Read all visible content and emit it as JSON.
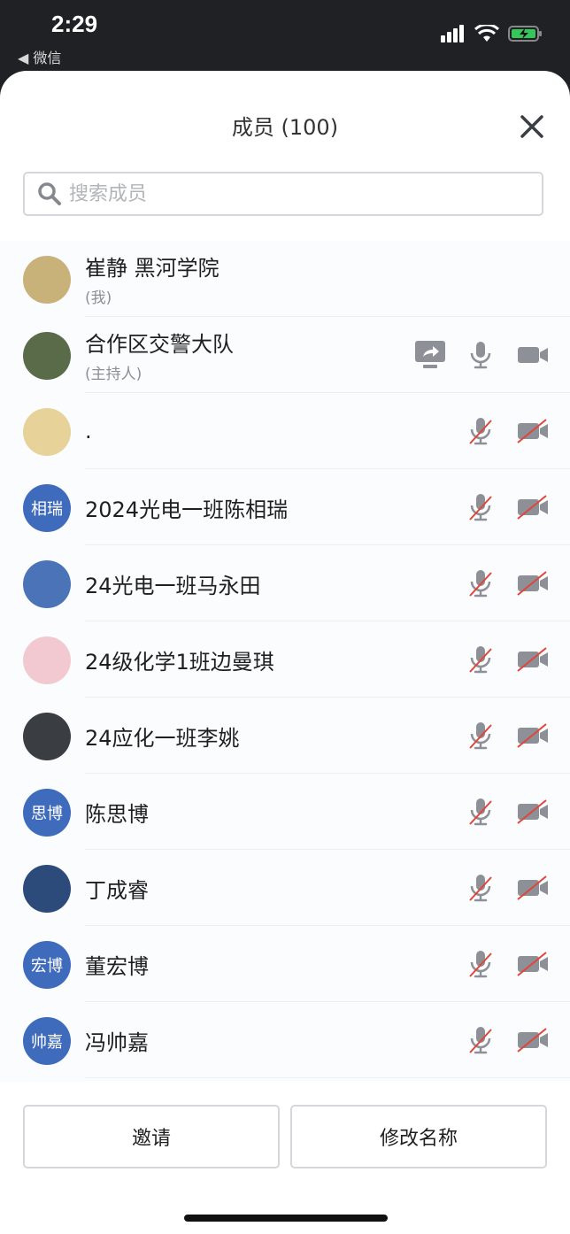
{
  "status_bar": {
    "time": "2:29",
    "back_app": "◀ 微信"
  },
  "sheet": {
    "title": "成员 (100)",
    "close_icon": "close-icon"
  },
  "search": {
    "placeholder": "搜索成员",
    "value": ""
  },
  "members": [
    {
      "name": "崔静 黑河学院",
      "sub": "(我)",
      "avatar_text": "",
      "avatar_color": "#c9b27a",
      "share": false,
      "mic": "none",
      "cam": "none"
    },
    {
      "name": "合作区交警大队",
      "sub": "(主持人)",
      "avatar_text": "",
      "avatar_color": "#5a6b4a",
      "share": true,
      "mic": "on",
      "cam": "on"
    },
    {
      "name": ".",
      "sub": "",
      "avatar_text": "",
      "avatar_color": "#e7d39a",
      "share": false,
      "mic": "off",
      "cam": "off"
    },
    {
      "name": "2024光电一班陈相瑞",
      "sub": "",
      "avatar_text": "相瑞",
      "avatar_color": "#3f6bbd",
      "share": false,
      "mic": "off",
      "cam": "off"
    },
    {
      "name": "24光电一班马永田",
      "sub": "",
      "avatar_text": "",
      "avatar_color": "#4b74b8",
      "share": false,
      "mic": "off",
      "cam": "off"
    },
    {
      "name": "24级化学1班边曼琪",
      "sub": "",
      "avatar_text": "",
      "avatar_color": "#f3c9d1",
      "share": false,
      "mic": "off",
      "cam": "off"
    },
    {
      "name": "24应化一班李姚",
      "sub": "",
      "avatar_text": "",
      "avatar_color": "#3a3d42",
      "share": false,
      "mic": "off",
      "cam": "off"
    },
    {
      "name": "陈思博",
      "sub": "",
      "avatar_text": "思博",
      "avatar_color": "#3f6bbd",
      "share": false,
      "mic": "off",
      "cam": "off"
    },
    {
      "name": "丁成睿",
      "sub": "",
      "avatar_text": "",
      "avatar_color": "#2c4a7a",
      "share": false,
      "mic": "off",
      "cam": "off"
    },
    {
      "name": "董宏博",
      "sub": "",
      "avatar_text": "宏博",
      "avatar_color": "#3f6bbd",
      "share": false,
      "mic": "off",
      "cam": "off"
    },
    {
      "name": "冯帅嘉",
      "sub": "",
      "avatar_text": "帅嘉",
      "avatar_color": "#3f6bbd",
      "share": false,
      "mic": "off",
      "cam": "off"
    }
  ],
  "footer": {
    "invite_label": "邀请",
    "rename_label": "修改名称"
  },
  "colors": {
    "avatar_blue": "#3f6bbd",
    "icon_gray": "#8d9096",
    "muted_red": "#e0453a"
  }
}
